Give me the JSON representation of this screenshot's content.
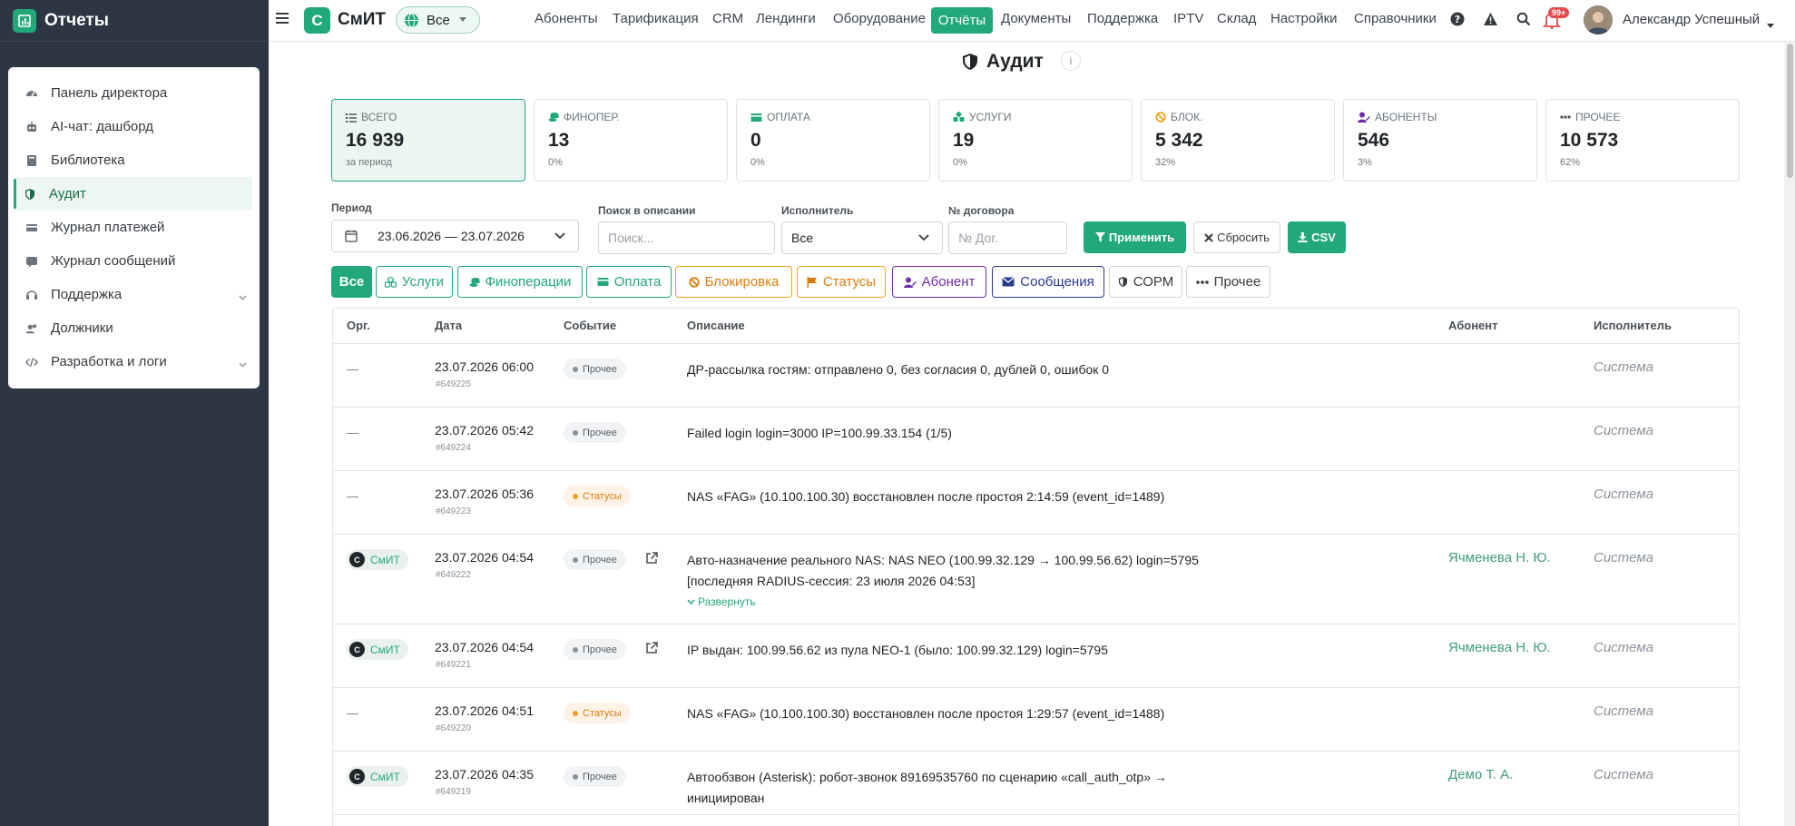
{
  "app": {
    "title": "Отчеты"
  },
  "sidebar": {
    "items": [
      {
        "label": "Панель директора",
        "icon": "dashboard-icon"
      },
      {
        "label": "AI-чат: дашборд",
        "icon": "robot-icon"
      },
      {
        "label": "Библиотека",
        "icon": "book-icon"
      },
      {
        "label": "Аудит",
        "icon": "shield-icon",
        "active": true
      },
      {
        "label": "Журнал платежей",
        "icon": "payments-icon"
      },
      {
        "label": "Журнал сообщений",
        "icon": "messages-icon"
      },
      {
        "label": "Поддержка",
        "icon": "support-icon",
        "submenu": true
      },
      {
        "label": "Должники",
        "icon": "users-icon"
      },
      {
        "label": "Разработка и логи",
        "icon": "code-icon",
        "submenu": true
      }
    ]
  },
  "topbar": {
    "logo_letter": "С",
    "logo_text": "СмИТ",
    "scope_label": "Все",
    "nav": [
      "Абоненты",
      "Тарификация",
      "CRM",
      "Лендинги",
      "Оборудование",
      "Отчёты",
      "Документы",
      "Поддержка",
      "IPTV",
      "Склад",
      "Настройки",
      "Справочники"
    ],
    "active_nav": "Отчёты",
    "notifications_badge": "99+",
    "user_name": "Александр Успешный"
  },
  "page": {
    "title": "Аудит",
    "info": "i"
  },
  "stats": [
    {
      "label": "Всего",
      "value": "16 939",
      "sub": "за период",
      "icon": "list-icon",
      "color": "#495057",
      "selected": true
    },
    {
      "label": "Финопер.",
      "value": "13",
      "sub": "0%",
      "icon": "coins-icon",
      "color": "#22a97a"
    },
    {
      "label": "Оплата",
      "value": "0",
      "sub": "0%",
      "icon": "money-icon",
      "color": "#22a97a"
    },
    {
      "label": "Услуги",
      "value": "19",
      "sub": "0%",
      "icon": "services-icon",
      "color": "#22a97a"
    },
    {
      "label": "Блок.",
      "value": "5 342",
      "sub": "32%",
      "icon": "block-icon",
      "color": "#f0a020"
    },
    {
      "label": "Абоненты",
      "value": "546",
      "sub": "3%",
      "icon": "user-edit-icon",
      "color": "#6f2da8"
    },
    {
      "label": "Прочее",
      "value": "10 573",
      "sub": "62%",
      "icon": "dots-icon",
      "color": "#495057"
    }
  ],
  "filters": {
    "period_label": "Период",
    "period_value": "23.06.2026 — 23.07.2026",
    "search_label": "Поиск в описании",
    "search_placeholder": "Поиск...",
    "executor_label": "Исполнитель",
    "executor_value": "Все",
    "contract_label": "№ договора",
    "contract_placeholder": "№ Дог.",
    "apply": "Применить",
    "reset": "Сбросить",
    "csv": "CSV"
  },
  "chips": [
    {
      "label": "Все",
      "icon": "",
      "color": "#22a97a",
      "filled": true
    },
    {
      "label": "Услуги",
      "icon": "services-icon",
      "color": "#22a97a"
    },
    {
      "label": "Финоперации",
      "icon": "coins-icon",
      "color": "#22a97a"
    },
    {
      "label": "Оплата",
      "icon": "money-icon",
      "color": "#22a97a"
    },
    {
      "label": "Блокировка",
      "icon": "block-icon",
      "color": "#d97d0d"
    },
    {
      "label": "Статусы",
      "icon": "flag-icon",
      "color": "#d97d0d"
    },
    {
      "label": "Абонент",
      "icon": "user-edit-icon",
      "color": "#6f2da8"
    },
    {
      "label": "Сообщения",
      "icon": "envelope-icon",
      "color": "#2b3a8c"
    },
    {
      "label": "СОРМ",
      "icon": "shield-icon",
      "color": "#495057"
    },
    {
      "label": "Прочее",
      "icon": "dots-icon",
      "color": "#495057"
    }
  ],
  "table": {
    "columns": [
      "Орг.",
      "Дата",
      "Событие",
      "Описание",
      "Абонент",
      "Исполнитель"
    ],
    "rows": [
      {
        "org": "—",
        "date": "23.07.2026 06:00",
        "id": "#649225",
        "event": "Прочее",
        "desc": [
          "ДР-рассылка гостям: отправлено 0, без согласия 0, дублей 0, ошибок 0"
        ],
        "subscriber": "",
        "executor": "Система"
      },
      {
        "org": "—",
        "date": "23.07.2026 05:42",
        "id": "#649224",
        "event": "Прочее",
        "desc": [
          "Failed login login=3000 IP=100.99.33.154 (1/5)"
        ],
        "subscriber": "",
        "executor": "Система"
      },
      {
        "org": "—",
        "date": "23.07.2026 05:36",
        "id": "#649223",
        "event": "Статусы",
        "desc": [
          "NAS «FAG» (10.100.100.30) восстановлен после простоя 2:14:59 (event_id=1489)"
        ],
        "subscriber": "",
        "executor": "Система"
      },
      {
        "org": "СмИТ",
        "date": "23.07.2026 04:54",
        "id": "#649222",
        "event": "Прочее",
        "desc": [
          "Авто-назначение реального NAS: NAS NEO (100.99.32.129 → 100.99.56.62) login=5795",
          "[последняя RADIUS-сессия: 23 июля 2026 04:53]"
        ],
        "expand": "Развернуть",
        "subscriber": "Ячменева Н. Ю.",
        "executor": "Система"
      },
      {
        "org": "СмИТ",
        "date": "23.07.2026 04:54",
        "id": "#649221",
        "event": "Прочее",
        "desc": [
          "IP выдан: 100.99.56.62 из пула NEO-1 (было: 100.99.32.129) login=5795"
        ],
        "subscriber": "Ячменева Н. Ю.",
        "executor": "Система"
      },
      {
        "org": "—",
        "date": "23.07.2026 04:51",
        "id": "#649220",
        "event": "Статусы",
        "desc": [
          "NAS «FAG» (10.100.100.30) восстановлен после простоя 1:29:57 (event_id=1488)"
        ],
        "subscriber": "",
        "executor": "Система"
      },
      {
        "org": "СмИТ",
        "date": "23.07.2026 04:35",
        "id": "#649219",
        "event": "Прочее",
        "desc": [
          "Автообзвон (Asterisk): робот-звонок 89169535760 по сценарию «call_auth_otp» →",
          "инициирован"
        ],
        "subscriber": "Демо Т. А.",
        "executor": "Система"
      }
    ]
  }
}
